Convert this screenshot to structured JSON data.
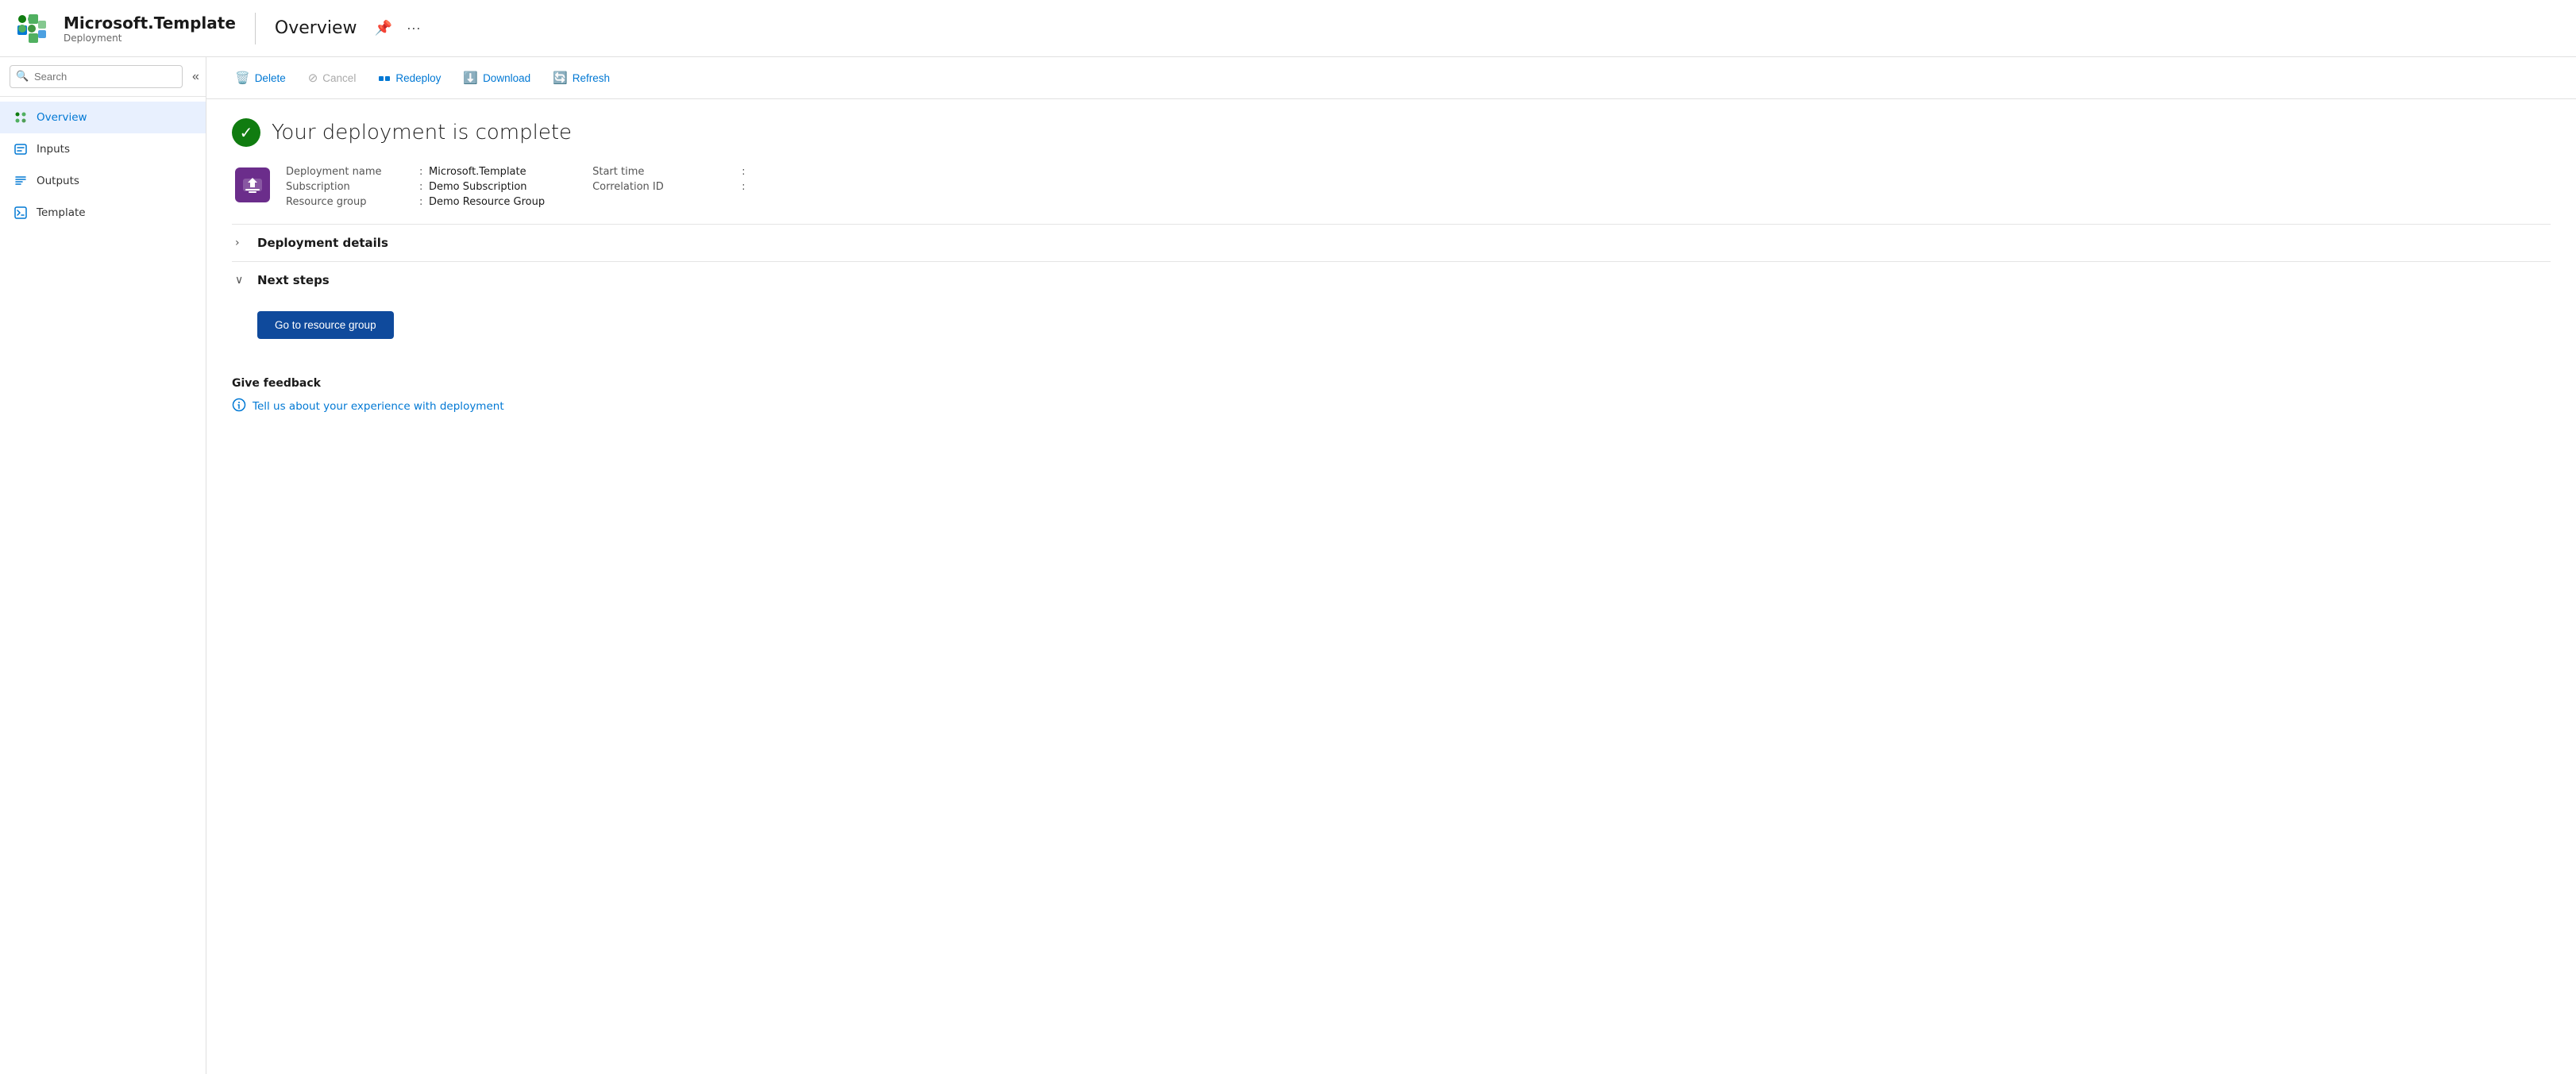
{
  "header": {
    "title": "Microsoft.Template",
    "subtitle": "Deployment",
    "divider": "|",
    "page_title": "Overview",
    "pin_tooltip": "Pin",
    "more_tooltip": "More"
  },
  "sidebar": {
    "search_placeholder": "Search",
    "collapse_label": "Collapse",
    "nav_items": [
      {
        "id": "overview",
        "label": "Overview",
        "active": true
      },
      {
        "id": "inputs",
        "label": "Inputs",
        "active": false
      },
      {
        "id": "outputs",
        "label": "Outputs",
        "active": false
      },
      {
        "id": "template",
        "label": "Template",
        "active": false
      }
    ]
  },
  "toolbar": {
    "delete_label": "Delete",
    "cancel_label": "Cancel",
    "redeploy_label": "Redeploy",
    "download_label": "Download",
    "refresh_label": "Refresh"
  },
  "deployment": {
    "complete_message": "Your deployment is complete",
    "name_label": "Deployment name",
    "name_value": "Microsoft.Template",
    "subscription_label": "Subscription",
    "subscription_value": "Demo Subscription",
    "resource_group_label": "Resource group",
    "resource_group_value": "Demo Resource Group",
    "start_time_label": "Start time",
    "start_time_value": "",
    "correlation_id_label": "Correlation ID",
    "correlation_id_value": ""
  },
  "sections": {
    "deployment_details_label": "Deployment details",
    "next_steps_label": "Next steps",
    "go_to_resource_group_label": "Go to resource group"
  },
  "feedback": {
    "title": "Give feedback",
    "link_text": "Tell us about your experience with deployment"
  }
}
